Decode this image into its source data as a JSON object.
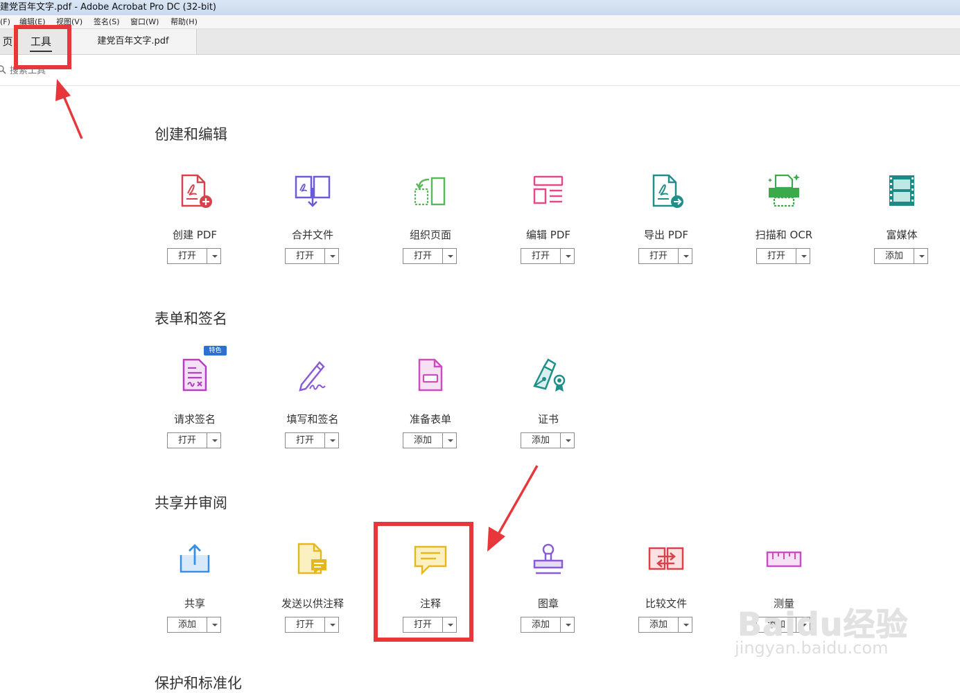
{
  "window": {
    "title": "建党百年文字.pdf - Adobe Acrobat Pro DC (32-bit)"
  },
  "menubar": [
    {
      "id": "file",
      "label": "(F)"
    },
    {
      "id": "edit",
      "label": "编辑(E)"
    },
    {
      "id": "view",
      "label": "视图(V)"
    },
    {
      "id": "sign",
      "label": "签名(S)"
    },
    {
      "id": "window",
      "label": "窗口(W)"
    },
    {
      "id": "help",
      "label": "帮助(H)"
    }
  ],
  "tabs": {
    "home": "页",
    "tools": "工具",
    "doc": "建党百年文字.pdf"
  },
  "search": {
    "placeholder": "搜索工具"
  },
  "sections": {
    "create_edit": {
      "title": "创建和编辑",
      "tools": [
        {
          "label": "创建 PDF",
          "action": "打开",
          "icon": "create-pdf-icon",
          "color": "#d8424a"
        },
        {
          "label": "合并文件",
          "action": "打开",
          "icon": "combine-files-icon",
          "color": "#6b5bd6"
        },
        {
          "label": "组织页面",
          "action": "打开",
          "icon": "organize-pages-icon",
          "color": "#5cb85c"
        },
        {
          "label": "编辑 PDF",
          "action": "打开",
          "icon": "edit-pdf-icon",
          "color": "#e24a8d"
        },
        {
          "label": "导出 PDF",
          "action": "打开",
          "icon": "export-pdf-icon",
          "color": "#1f8f8a"
        },
        {
          "label": "扫描和 OCR",
          "action": "打开",
          "icon": "scan-ocr-icon",
          "color": "#3aaa4a"
        },
        {
          "label": "富媒体",
          "action": "添加",
          "icon": "rich-media-icon",
          "color": "#1a8c88"
        }
      ]
    },
    "forms_sign": {
      "title": "表单和签名",
      "badge": "特色",
      "tools": [
        {
          "label": "请求签名",
          "action": "打开",
          "icon": "request-signature-icon",
          "color": "#b43fbf"
        },
        {
          "label": "填写和签名",
          "action": "打开",
          "icon": "fill-sign-icon",
          "color": "#8a5bd6"
        },
        {
          "label": "准备表单",
          "action": "添加",
          "icon": "prepare-form-icon",
          "color": "#c94fbf"
        },
        {
          "label": "证书",
          "action": "添加",
          "icon": "certificate-icon",
          "color": "#1f8f8a"
        }
      ]
    },
    "share_review": {
      "title": "共享并审阅",
      "tools": [
        {
          "label": "共享",
          "action": "添加",
          "icon": "share-icon",
          "color": "#3a8ee0"
        },
        {
          "label": "发送以供注释",
          "action": "打开",
          "icon": "send-for-comments-icon",
          "color": "#e6b820"
        },
        {
          "label": "注释",
          "action": "打开",
          "icon": "comment-icon",
          "color": "#e6b820"
        },
        {
          "label": "图章",
          "action": "添加",
          "icon": "stamp-icon",
          "color": "#8a5bd6"
        },
        {
          "label": "比较文件",
          "action": "添加",
          "icon": "compare-files-icon",
          "color": "#d8424a"
        },
        {
          "label": "测量",
          "action": "添加",
          "icon": "measure-icon",
          "color": "#c94fbf"
        }
      ]
    },
    "protect_standardize": {
      "title": "保护和标准化"
    }
  },
  "watermark": {
    "brand": "Baidu经验",
    "url": "jingyan.baidu.com"
  },
  "annotation_color": "#e8373a"
}
